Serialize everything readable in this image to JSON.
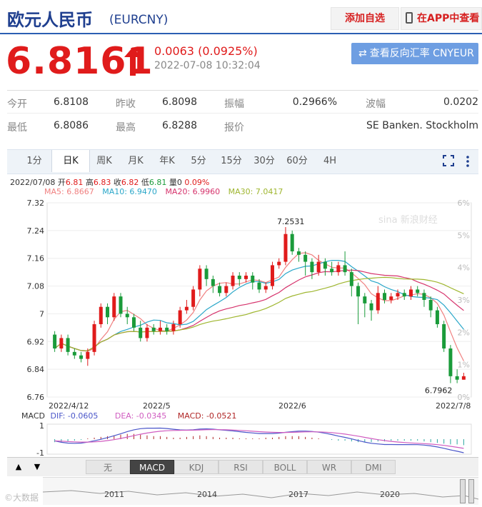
{
  "header": {
    "title": "欧元人民币",
    "code": "(EURCNY)",
    "add_watch": "添加自选",
    "view_app": "在APP中查看"
  },
  "quote": {
    "price": "6.8161",
    "change": "0.0063 (0.0925%)",
    "time": "2022-07-08 10:32:04",
    "reverse_button": "查看反向汇率 CNYEUR"
  },
  "stats": [
    {
      "label": "今开",
      "value": "6.8108"
    },
    {
      "label": "昨收",
      "value": "6.8098"
    },
    {
      "label": "振幅",
      "value": "0.2966%"
    },
    {
      "label": "波幅",
      "value": "0.0202"
    },
    {
      "label": "最低",
      "value": "6.8086"
    },
    {
      "label": "最高",
      "value": "6.8288"
    },
    {
      "label": "报价",
      "value": "SE Banken. Stockholm"
    }
  ],
  "tabs": [
    "1分",
    "日K",
    "周K",
    "月K",
    "年K",
    "5分",
    "15分",
    "30分",
    "60分",
    "4H"
  ],
  "active_tab": "日K",
  "info": {
    "date": "2022/07/08",
    "open_l": "开",
    "open_v": "6.81",
    "high_l": "高",
    "high_v": "6.83",
    "close_l": "收",
    "close_v": "6.82",
    "low_l": "低",
    "low_v": "6.81",
    "vol_l": "量",
    "vol_v": "0",
    "pct": "0.09%",
    "ma5": "MA5: 6.8667",
    "ma10": "MA10: 6.9470",
    "ma20": "MA20: 6.9960",
    "ma30": "MA30: 7.0417"
  },
  "watermark": "sina 新浪财经",
  "macd": {
    "title": "MACD",
    "dif": "DIF: -0.0605",
    "dea": "DEA: -0.0345",
    "macd": "MACD: -0.0521",
    "y_top": "1",
    "y_bottom": "-1"
  },
  "indicators": [
    "无",
    "MACD",
    "KDJ",
    "RSI",
    "BOLL",
    "WR",
    "DMI"
  ],
  "active_indicator": "MACD",
  "nav": {
    "up": "▲",
    "down": "▼"
  },
  "timeline": [
    "2011",
    "2014",
    "2017",
    "2020"
  ],
  "bottom_watermark": "©大数据",
  "colors": {
    "up": "#e01b1b",
    "down": "#1a9b3a",
    "ma5": "#f08080",
    "ma10": "#2aa7c9",
    "ma20": "#d6336c",
    "ma30": "#9fb62f",
    "accent": "#2b5fb3"
  },
  "chart_data": {
    "type": "candlestick",
    "title": "",
    "y_ticks": [
      "7.32",
      "7.24",
      "7.16",
      "7.08",
      "7",
      "6.92",
      "6.84",
      "6.76"
    ],
    "ylim": [
      6.76,
      7.32
    ],
    "y2_ticks": [
      "6%",
      "5%",
      "4%",
      "3%",
      "2%",
      "1%",
      "0%"
    ],
    "x_labels": [
      "2022/4/12",
      "2022/5",
      "2022/6",
      "2022/7/8"
    ],
    "annotations": [
      {
        "text": "7.2531"
      },
      {
        "text": "6.7962"
      }
    ],
    "candles": [
      [
        6.94,
        6.9,
        6.95,
        6.89
      ],
      [
        6.9,
        6.93,
        6.94,
        6.89
      ],
      [
        6.93,
        6.89,
        6.94,
        6.88
      ],
      [
        6.89,
        6.88,
        6.9,
        6.87
      ],
      [
        6.88,
        6.87,
        6.89,
        6.86
      ],
      [
        6.87,
        6.89,
        6.9,
        6.85
      ],
      [
        6.89,
        6.97,
        6.98,
        6.88
      ],
      [
        6.97,
        7.02,
        7.03,
        6.96
      ],
      [
        7.02,
        6.99,
        7.03,
        6.97
      ],
      [
        6.99,
        7.05,
        7.06,
        6.98
      ],
      [
        7.05,
        7.0,
        7.06,
        6.99
      ],
      [
        7.0,
        6.99,
        7.02,
        6.97
      ],
      [
        6.99,
        6.96,
        7.0,
        6.95
      ],
      [
        6.96,
        6.93,
        6.98,
        6.92
      ],
      [
        6.93,
        6.96,
        6.97,
        6.92
      ],
      [
        6.96,
        6.95,
        6.97,
        6.94
      ],
      [
        6.95,
        6.96,
        6.98,
        6.94
      ],
      [
        6.96,
        6.95,
        6.97,
        6.94
      ],
      [
        6.95,
        6.97,
        6.98,
        6.94
      ],
      [
        6.97,
        7.01,
        7.02,
        6.96
      ],
      [
        7.01,
        7.02,
        7.04,
        7.0
      ],
      [
        7.02,
        7.07,
        7.08,
        7.01
      ],
      [
        7.07,
        7.13,
        7.14,
        7.05
      ],
      [
        7.13,
        7.1,
        7.14,
        7.08
      ],
      [
        7.1,
        7.08,
        7.11,
        7.06
      ],
      [
        7.08,
        7.06,
        7.09,
        7.05
      ],
      [
        7.06,
        7.08,
        7.09,
        7.05
      ],
      [
        7.08,
        7.11,
        7.12,
        7.07
      ],
      [
        7.11,
        7.1,
        7.12,
        7.08
      ],
      [
        7.1,
        7.11,
        7.12,
        7.09
      ],
      [
        7.11,
        7.09,
        7.12,
        7.07
      ],
      [
        7.09,
        7.07,
        7.1,
        7.06
      ],
      [
        7.07,
        7.08,
        7.09,
        7.06
      ],
      [
        7.08,
        7.14,
        7.15,
        7.07
      ],
      [
        7.14,
        7.15,
        7.16,
        7.13
      ],
      [
        7.15,
        7.23,
        7.25,
        7.14
      ],
      [
        7.23,
        7.18,
        7.24,
        7.17
      ],
      [
        7.18,
        7.17,
        7.19,
        7.15
      ],
      [
        7.17,
        7.15,
        7.18,
        7.11
      ],
      [
        7.15,
        7.12,
        7.16,
        7.1
      ],
      [
        7.12,
        7.15,
        7.17,
        7.11
      ],
      [
        7.15,
        7.13,
        7.16,
        7.11
      ],
      [
        7.13,
        7.12,
        7.15,
        7.11
      ],
      [
        7.12,
        7.14,
        7.15,
        7.11
      ],
      [
        7.14,
        7.12,
        7.18,
        7.11
      ],
      [
        7.12,
        7.08,
        7.13,
        7.05
      ],
      [
        7.08,
        7.05,
        7.09,
        6.97
      ],
      [
        7.05,
        7.03,
        7.06,
        6.99
      ],
      [
        7.03,
        7.01,
        7.04,
        6.98
      ],
      [
        7.01,
        7.06,
        7.08,
        7.0
      ],
      [
        7.06,
        7.04,
        7.07,
        7.03
      ],
      [
        7.04,
        7.05,
        7.06,
        7.03
      ],
      [
        7.05,
        7.06,
        7.07,
        7.04
      ],
      [
        7.06,
        7.05,
        7.07,
        7.04
      ],
      [
        7.05,
        7.07,
        7.08,
        7.04
      ],
      [
        7.07,
        7.06,
        7.08,
        7.05
      ],
      [
        7.06,
        7.04,
        7.07,
        7.02
      ],
      [
        7.04,
        7.01,
        7.05,
        6.99
      ],
      [
        7.01,
        6.97,
        7.02,
        6.96
      ],
      [
        6.97,
        6.9,
        6.98,
        6.89
      ],
      [
        6.9,
        6.82,
        6.91,
        6.8
      ],
      [
        6.82,
        6.81,
        6.84,
        6.8
      ],
      [
        6.81,
        6.82,
        6.83,
        6.81
      ]
    ],
    "macd_hist": [
      -0.2,
      -0.2,
      -0.15,
      -0.1,
      -0.05,
      0.05,
      0.1,
      0.15,
      0.2,
      0.25,
      0.3,
      0.35,
      0.35,
      0.3,
      0.25,
      0.2,
      0.2,
      0.15,
      0.1,
      0.1,
      0.15,
      0.2,
      0.25,
      0.2,
      0.15,
      0.1,
      0.1,
      0.1,
      0.05,
      0.05,
      0.05,
      0.05,
      0.1,
      0.1,
      0.15,
      0.2,
      0.2,
      0.2,
      0.15,
      0.1,
      0.05,
      0,
      -0.05,
      -0.1,
      -0.1,
      -0.15,
      -0.2,
      -0.2,
      -0.2,
      -0.15,
      -0.15,
      -0.1,
      -0.1,
      -0.1,
      -0.1,
      -0.1,
      -0.15,
      -0.2,
      -0.25,
      -0.3,
      -0.35,
      -0.35,
      -0.4
    ],
    "macd_ylim": [
      -1,
      1
    ]
  }
}
